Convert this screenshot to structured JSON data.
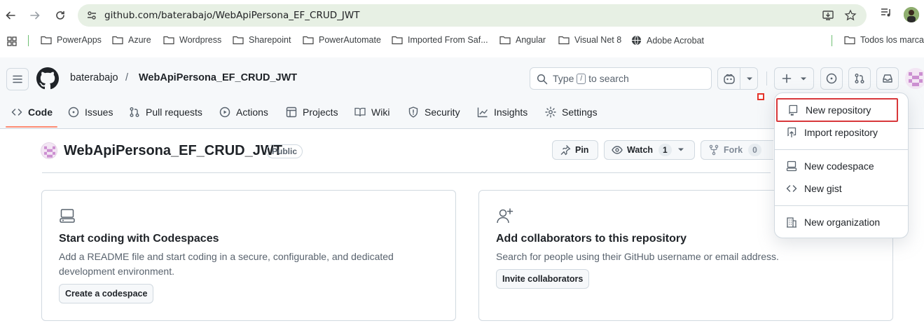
{
  "browser": {
    "url": "github.com/baterabajo/WebApiPersona_EF_CRUD_JWT",
    "bookmarks": [
      "PowerApps",
      "Azure",
      "Wordpress",
      "Sharepoint",
      "PowerAutomate",
      "Imported From Saf...",
      "Angular",
      "Visual Net 8",
      "Adobe Acrobat"
    ],
    "all_bookmarks": "Todos los marcad"
  },
  "header": {
    "owner": "baterabajo",
    "separator": "/",
    "repo": "WebApiPersona_EF_CRUD_JWT",
    "search_prefix": "Type",
    "search_key": "/",
    "search_suffix": "to search"
  },
  "tabs": [
    "Code",
    "Issues",
    "Pull requests",
    "Actions",
    "Projects",
    "Wiki",
    "Security",
    "Insights",
    "Settings"
  ],
  "repo": {
    "title": "WebApiPersona_EF_CRUD_JWT",
    "visibility": "Public",
    "pin_label": "Pin",
    "watch_label": "Watch",
    "watch_count": "1",
    "fork_label": "Fork",
    "fork_count": "0"
  },
  "cards": {
    "codespaces": {
      "title": "Start coding with Codespaces",
      "desc": "Add a README file and start coding in a secure, configurable, and dedicated development environment.",
      "button": "Create a codespace"
    },
    "collaborators": {
      "title": "Add collaborators to this repository",
      "desc": "Search for people using their GitHub username or email address.",
      "button": "Invite collaborators"
    }
  },
  "create_menu": {
    "items": [
      "New repository",
      "Import repository",
      "New codespace",
      "New gist",
      "New organization"
    ],
    "highlighted": "New repository"
  },
  "colors": {
    "accent_underline": "#fd8c73",
    "highlight_box": "#d8373a",
    "omnibox_bg": "#e7f0e4"
  }
}
